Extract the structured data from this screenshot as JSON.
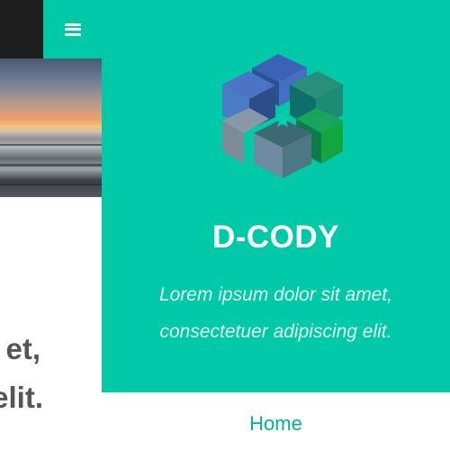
{
  "site": {
    "title": "D-CODY",
    "tagline_line1": "Lorem ipsum dolor sit amet,",
    "tagline_line2": "consectetuer adipiscing elit."
  },
  "menu_toggle": {
    "icon": "hamburger-icon"
  },
  "navigation": {
    "items": [
      {
        "label": "Home"
      }
    ]
  },
  "background_content": {
    "heading_line1_fragment": "et,",
    "heading_line2_fragment": "elit."
  },
  "colors": {
    "accent": "#00c9a7",
    "dark_bar": "#1f1f1f",
    "heading_text": "#555555",
    "link": "#00b394"
  }
}
